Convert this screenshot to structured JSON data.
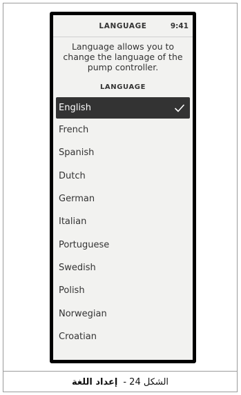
{
  "screen": {
    "title": "LANGUAGE",
    "time": "9:41",
    "description": "Language allows you to change the language of the pump controller.",
    "section_label": "LANGUAGE",
    "languages": [
      {
        "label": "English",
        "selected": true
      },
      {
        "label": "French",
        "selected": false
      },
      {
        "label": "Spanish",
        "selected": false
      },
      {
        "label": "Dutch",
        "selected": false
      },
      {
        "label": "German",
        "selected": false
      },
      {
        "label": "Italian",
        "selected": false
      },
      {
        "label": "Portuguese",
        "selected": false
      },
      {
        "label": "Swedish",
        "selected": false
      },
      {
        "label": "Polish",
        "selected": false
      },
      {
        "label": "Norwegian",
        "selected": false
      },
      {
        "label": "Croatian",
        "selected": false
      }
    ]
  },
  "caption": {
    "prefix": "الشكل 24 -",
    "title": "إعداد اللغة"
  },
  "colors": {
    "selected_background": "#333333",
    "screen_background": "#f2f2f0",
    "device_border": "#000000"
  }
}
